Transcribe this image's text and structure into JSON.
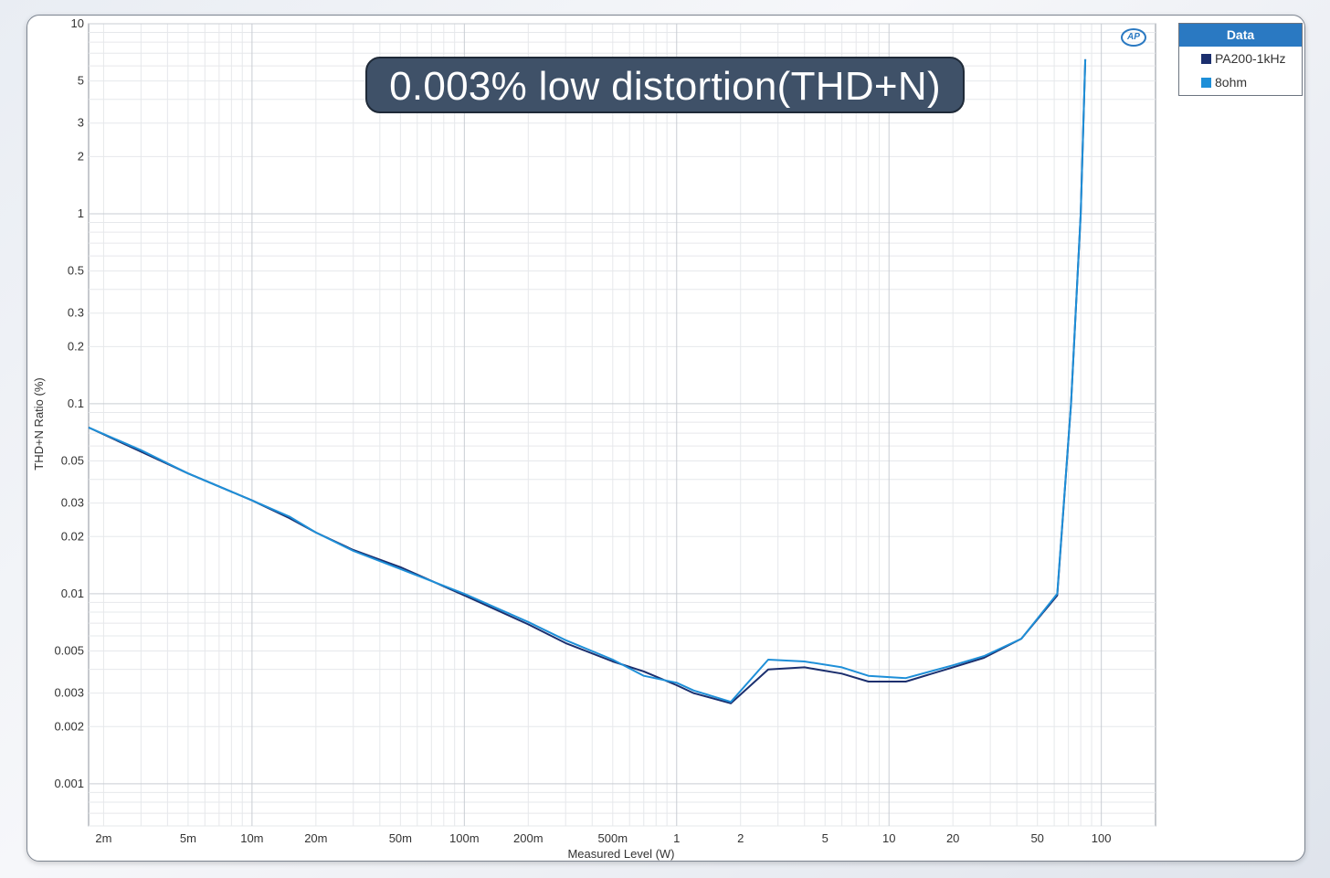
{
  "banner_text": "0.003% low distortion(THD+N)",
  "logo_text": "AP",
  "legend": {
    "title": "Data",
    "items": [
      {
        "label": "PA200-1kHz",
        "color": "#1b2f6e"
      },
      {
        "label": "8ohm",
        "color": "#1e8fd8"
      }
    ]
  },
  "chart_data": {
    "type": "line",
    "title": "",
    "xlabel": "Measured Level (W)",
    "ylabel": "THD+N Ratio (%)",
    "x_scale": "log",
    "y_scale": "log",
    "xlim": [
      0.0017,
      180
    ],
    "ylim": [
      0.0006,
      10
    ],
    "grid": true,
    "legend_position": "top-right",
    "x_ticks": [
      {
        "v": 0.002,
        "label": "2m"
      },
      {
        "v": 0.005,
        "label": "5m"
      },
      {
        "v": 0.01,
        "label": "10m"
      },
      {
        "v": 0.02,
        "label": "20m"
      },
      {
        "v": 0.05,
        "label": "50m"
      },
      {
        "v": 0.1,
        "label": "100m"
      },
      {
        "v": 0.2,
        "label": "200m"
      },
      {
        "v": 0.5,
        "label": "500m"
      },
      {
        "v": 1,
        "label": "1"
      },
      {
        "v": 2,
        "label": "2"
      },
      {
        "v": 5,
        "label": "5"
      },
      {
        "v": 10,
        "label": "10"
      },
      {
        "v": 20,
        "label": "20"
      },
      {
        "v": 50,
        "label": "50"
      },
      {
        "v": 100,
        "label": "100"
      }
    ],
    "y_ticks": [
      {
        "v": 10,
        "label": "10"
      },
      {
        "v": 5,
        "label": "5"
      },
      {
        "v": 3,
        "label": "3"
      },
      {
        "v": 2,
        "label": "2"
      },
      {
        "v": 1,
        "label": "1"
      },
      {
        "v": 0.5,
        "label": "0.5"
      },
      {
        "v": 0.3,
        "label": "0.3"
      },
      {
        "v": 0.2,
        "label": "0.2"
      },
      {
        "v": 0.1,
        "label": "0.1"
      },
      {
        "v": 0.05,
        "label": "0.05"
      },
      {
        "v": 0.03,
        "label": "0.03"
      },
      {
        "v": 0.02,
        "label": "0.02"
      },
      {
        "v": 0.01,
        "label": "0.01"
      },
      {
        "v": 0.005,
        "label": "0.005"
      },
      {
        "v": 0.003,
        "label": "0.003"
      },
      {
        "v": 0.002,
        "label": "0.002"
      },
      {
        "v": 0.001,
        "label": "0.001"
      }
    ],
    "series": [
      {
        "name": "PA200-1kHz",
        "color": "#1b2f6e",
        "points": [
          [
            0.0017,
            0.075
          ],
          [
            0.003,
            0.056
          ],
          [
            0.005,
            0.043
          ],
          [
            0.01,
            0.031
          ],
          [
            0.015,
            0.025
          ],
          [
            0.02,
            0.021
          ],
          [
            0.03,
            0.017
          ],
          [
            0.05,
            0.0138
          ],
          [
            0.1,
            0.0098
          ],
          [
            0.2,
            0.0069
          ],
          [
            0.3,
            0.0055
          ],
          [
            0.5,
            0.0044
          ],
          [
            0.7,
            0.0039
          ],
          [
            1.0,
            0.0033
          ],
          [
            1.2,
            0.003
          ],
          [
            1.8,
            0.00265
          ],
          [
            2.7,
            0.004
          ],
          [
            4.0,
            0.0041
          ],
          [
            6.0,
            0.0038
          ],
          [
            8.0,
            0.00345
          ],
          [
            12.0,
            0.00345
          ],
          [
            20.0,
            0.0041
          ],
          [
            28.0,
            0.0046
          ],
          [
            42.0,
            0.0058
          ],
          [
            62.0,
            0.0098
          ],
          [
            72.0,
            0.1
          ],
          [
            80.0,
            1.0
          ],
          [
            84.0,
            6.5
          ]
        ]
      },
      {
        "name": "8ohm",
        "color": "#1e8fd8",
        "points": [
          [
            0.0017,
            0.075
          ],
          [
            0.003,
            0.057
          ],
          [
            0.005,
            0.043
          ],
          [
            0.01,
            0.031
          ],
          [
            0.015,
            0.0255
          ],
          [
            0.02,
            0.021
          ],
          [
            0.03,
            0.0168
          ],
          [
            0.05,
            0.0135
          ],
          [
            0.1,
            0.01
          ],
          [
            0.2,
            0.0071
          ],
          [
            0.3,
            0.0057
          ],
          [
            0.5,
            0.0045
          ],
          [
            0.7,
            0.0037
          ],
          [
            1.0,
            0.0034
          ],
          [
            1.2,
            0.0031
          ],
          [
            1.8,
            0.0027
          ],
          [
            2.7,
            0.0045
          ],
          [
            4.0,
            0.0044
          ],
          [
            6.0,
            0.0041
          ],
          [
            8.0,
            0.0037
          ],
          [
            12.0,
            0.0036
          ],
          [
            20.0,
            0.0042
          ],
          [
            28.0,
            0.0047
          ],
          [
            42.0,
            0.0058
          ],
          [
            62.0,
            0.01
          ],
          [
            72.0,
            0.1
          ],
          [
            80.0,
            1.0
          ],
          [
            84.0,
            6.5
          ]
        ]
      }
    ]
  }
}
